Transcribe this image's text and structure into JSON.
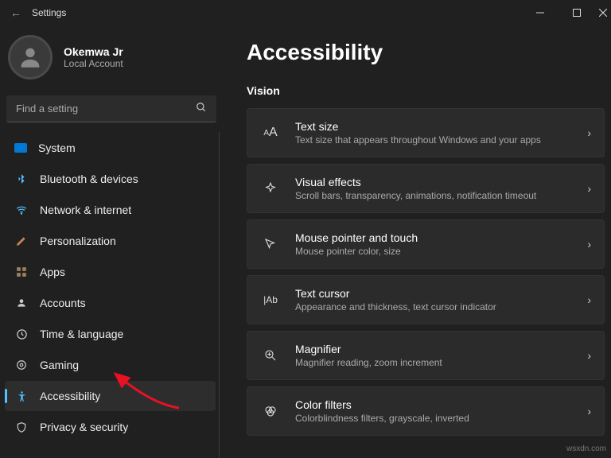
{
  "window": {
    "title": "Settings"
  },
  "profile": {
    "name": "Okemwa Jr",
    "sub": "Local Account"
  },
  "search": {
    "placeholder": "Find a setting"
  },
  "nav": [
    {
      "key": "system",
      "label": "System",
      "color": "#0078d4"
    },
    {
      "key": "bluetooth",
      "label": "Bluetooth & devices",
      "color": "#4cc2ff"
    },
    {
      "key": "network",
      "label": "Network & internet",
      "color": "#4cc2ff"
    },
    {
      "key": "personalization",
      "label": "Personalization",
      "color": "#d08050"
    },
    {
      "key": "apps",
      "label": "Apps",
      "color": "#a08060"
    },
    {
      "key": "accounts",
      "label": "Accounts",
      "color": "#888"
    },
    {
      "key": "time",
      "label": "Time & language",
      "color": "#888"
    },
    {
      "key": "gaming",
      "label": "Gaming",
      "color": "#888"
    },
    {
      "key": "accessibility",
      "label": "Accessibility",
      "color": "#4cc2ff",
      "active": true
    },
    {
      "key": "privacy",
      "label": "Privacy & security",
      "color": "#888"
    }
  ],
  "page": {
    "title": "Accessibility"
  },
  "section": {
    "vision": "Vision"
  },
  "cards": [
    {
      "key": "textsize",
      "title": "Text size",
      "sub": "Text size that appears throughout Windows and your apps"
    },
    {
      "key": "visual",
      "title": "Visual effects",
      "sub": "Scroll bars, transparency, animations, notification timeout"
    },
    {
      "key": "mouse",
      "title": "Mouse pointer and touch",
      "sub": "Mouse pointer color, size"
    },
    {
      "key": "textcursor",
      "title": "Text cursor",
      "sub": "Appearance and thickness, text cursor indicator"
    },
    {
      "key": "magnifier",
      "title": "Magnifier",
      "sub": "Magnifier reading, zoom increment"
    },
    {
      "key": "colorfilters",
      "title": "Color filters",
      "sub": "Colorblindness filters, grayscale, inverted"
    }
  ],
  "watermark": "wsxdn.com"
}
